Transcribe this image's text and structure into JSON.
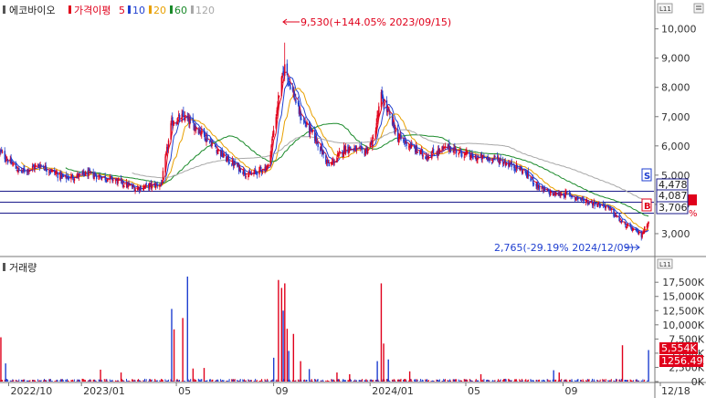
{
  "legend": {
    "title": "에코바이오",
    "indicator": "가격이평",
    "ma": [
      {
        "period": "5",
        "color": "#e0001b"
      },
      {
        "period": "10",
        "color": "#2040d0"
      },
      {
        "period": "20",
        "color": "#e8a000"
      },
      {
        "period": "60",
        "color": "#1a8a2a"
      },
      {
        "period": "120",
        "color": "#a8a8a8"
      }
    ]
  },
  "volume_title": "거래량",
  "annotations": {
    "high": "9,530(+144.05% 2023/09/15)",
    "low": "2,765(-29.19% 2024/12/09)",
    "s_marker": "S",
    "b_marker": "B",
    "line_labels": [
      "4,478",
      "4,087",
      "3,706"
    ],
    "current_price_tag": "",
    "pct_tag": "%",
    "vol_current": "5,554K",
    "vol_pct": "1256.49%"
  },
  "colors": {
    "up": "#e0001b",
    "down": "#1f3fd0",
    "hline": "#1a1a8a",
    "axis": "#888888"
  },
  "chart_data": [
    {
      "type": "candlestick",
      "title": "에코바이오",
      "y_ticks": [
        "3,000",
        "4,000",
        "5,000",
        "6,000",
        "7,000",
        "8,000",
        "9,000",
        "10,000"
      ],
      "y_tick_values": [
        3000,
        4000,
        5000,
        6000,
        7000,
        8000,
        9000,
        10000
      ],
      "ylim": [
        2250,
        10800
      ],
      "x_ticks": [
        "2022/10",
        "2023/01",
        "05",
        "09",
        "2024/01",
        "05",
        "09",
        "12/18"
      ],
      "x_tick_dates": [
        "2022-10-01",
        "2023-01-01",
        "2023-05-01",
        "2023-09-01",
        "2024-01-01",
        "2024-05-01",
        "2024-09-01",
        "2024-12-18"
      ],
      "date_range": [
        "2022-09-20",
        "2024-12-18"
      ],
      "price_path": [
        [
          "2022-09-20",
          5800
        ],
        [
          "2022-10-15",
          5100
        ],
        [
          "2022-11-10",
          5350
        ],
        [
          "2022-12-10",
          4900
        ],
        [
          "2023-01-10",
          5050
        ],
        [
          "2023-02-10",
          4850
        ],
        [
          "2023-03-10",
          4550
        ],
        [
          "2023-04-12",
          4700
        ],
        [
          "2023-04-25",
          6800
        ],
        [
          "2023-05-10",
          7000
        ],
        [
          "2023-06-01",
          6500
        ],
        [
          "2023-07-01",
          5600
        ],
        [
          "2023-08-01",
          5000
        ],
        [
          "2023-08-25",
          5300
        ],
        [
          "2023-09-08",
          7800
        ],
        [
          "2023-09-15",
          8700
        ],
        [
          "2023-10-05",
          7000
        ],
        [
          "2023-10-25",
          6200
        ],
        [
          "2023-11-10",
          5300
        ],
        [
          "2023-12-01",
          5950
        ],
        [
          "2023-12-25",
          5800
        ],
        [
          "2024-01-05",
          6200
        ],
        [
          "2024-01-15",
          7700
        ],
        [
          "2024-02-05",
          6300
        ],
        [
          "2024-03-10",
          5650
        ],
        [
          "2024-04-10",
          5950
        ],
        [
          "2024-05-10",
          5600
        ],
        [
          "2024-06-10",
          5550
        ],
        [
          "2024-07-10",
          5200
        ],
        [
          "2024-08-05",
          4500
        ],
        [
          "2024-08-20",
          4350
        ],
        [
          "2024-09-05",
          4350
        ],
        [
          "2024-10-01",
          4100
        ],
        [
          "2024-10-25",
          3950
        ],
        [
          "2024-11-15",
          3350
        ],
        [
          "2024-12-09",
          2950
        ],
        [
          "2024-12-18",
          3450
        ]
      ],
      "high": {
        "value": 9530,
        "date": "2023-09-15",
        "change": "+144.05%"
      },
      "low": {
        "value": 2765,
        "date": "2024-12-09",
        "change": "-29.19%"
      },
      "horizontal_lines": [
        4478,
        4087,
        3706
      ],
      "moving_averages": [
        "5",
        "10",
        "20",
        "60",
        "120"
      ],
      "grid": false,
      "legend_position": "top-left"
    },
    {
      "type": "bar",
      "title": "거래량",
      "y_ticks": [
        "0K",
        "2,500K",
        "5,000K",
        "7,500K",
        "10,000K",
        "12,500K",
        "15,000K",
        "17,500K"
      ],
      "y_tick_values": [
        0,
        2500,
        5000,
        7500,
        10000,
        12500,
        15000,
        17500
      ],
      "ylim": [
        0,
        19300
      ],
      "unit": "K",
      "spikes": [
        [
          "2022-09-21",
          7800
        ],
        [
          "2022-09-27",
          3200
        ],
        [
          "2023-01-25",
          2100
        ],
        [
          "2023-02-20",
          1600
        ],
        [
          "2023-04-25",
          12800
        ],
        [
          "2023-04-28",
          9200
        ],
        [
          "2023-05-09",
          11200
        ],
        [
          "2023-05-15",
          18500
        ],
        [
          "2023-05-22",
          2300
        ],
        [
          "2023-06-05",
          2400
        ],
        [
          "2023-09-01",
          4200
        ],
        [
          "2023-09-07",
          17900
        ],
        [
          "2023-09-11",
          16500
        ],
        [
          "2023-09-13",
          12500
        ],
        [
          "2023-09-15",
          17300
        ],
        [
          "2023-09-18",
          9300
        ],
        [
          "2023-09-20",
          5400
        ],
        [
          "2023-09-26",
          8400
        ],
        [
          "2023-10-05",
          3600
        ],
        [
          "2023-10-16",
          2200
        ],
        [
          "2023-11-20",
          1600
        ],
        [
          "2023-12-06",
          1300
        ],
        [
          "2024-01-10",
          3600
        ],
        [
          "2024-01-15",
          17300
        ],
        [
          "2024-01-18",
          6700
        ],
        [
          "2024-01-24",
          3900
        ],
        [
          "2024-02-20",
          1800
        ],
        [
          "2024-05-20",
          1300
        ],
        [
          "2024-08-20",
          2000
        ],
        [
          "2024-08-27",
          1600
        ],
        [
          "2024-11-15",
          6400
        ],
        [
          "2024-12-18",
          5554
        ]
      ],
      "grid": false
    }
  ]
}
